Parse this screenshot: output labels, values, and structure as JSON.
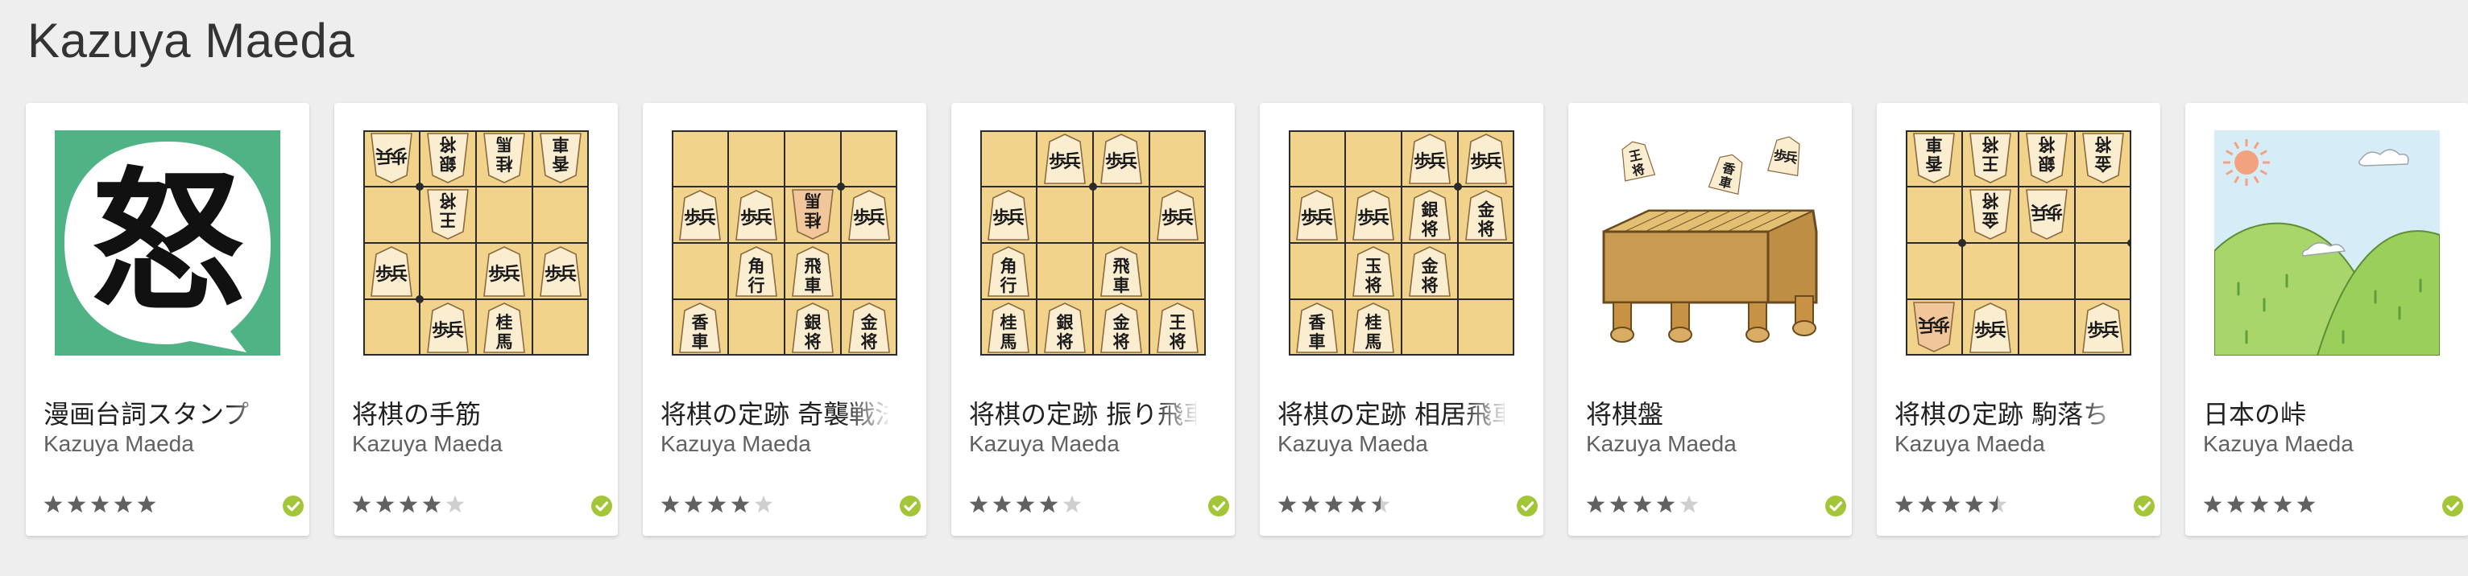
{
  "page": {
    "developer_title": "Kazuya Maeda"
  },
  "colors": {
    "star_filled": "#616161",
    "star_empty": "#cfcfcf",
    "verified_check": "#a3c639"
  },
  "apps": [
    {
      "title": "漫画台詞スタンプ",
      "developer": "Kazuya Maeda",
      "rating": 5.0,
      "icon": "manga-speech-bubble-icon"
    },
    {
      "title": "将棋の手筋",
      "developer": "Kazuya Maeda",
      "rating": 4.0,
      "icon": "shogi-board-icon"
    },
    {
      "title": "将棋の定跡 奇襲戦法",
      "developer": "Kazuya Maeda",
      "rating": 4.0,
      "icon": "shogi-board-icon"
    },
    {
      "title": "将棋の定跡 振り飛車",
      "developer": "Kazuya Maeda",
      "rating": 4.0,
      "icon": "shogi-board-icon"
    },
    {
      "title": "将棋の定跡 相居飛車",
      "developer": "Kazuya Maeda",
      "rating": 4.5,
      "icon": "shogi-board-icon"
    },
    {
      "title": "将棋盤",
      "developer": "Kazuya Maeda",
      "rating": 4.0,
      "icon": "shogi-table-icon"
    },
    {
      "title": "将棋の定跡 駒落ち",
      "developer": "Kazuya Maeda",
      "rating": 4.5,
      "icon": "shogi-board-icon"
    },
    {
      "title": "日本の峠",
      "developer": "Kazuya Maeda",
      "rating": 5.0,
      "icon": "mountain-pass-icon"
    }
  ]
}
